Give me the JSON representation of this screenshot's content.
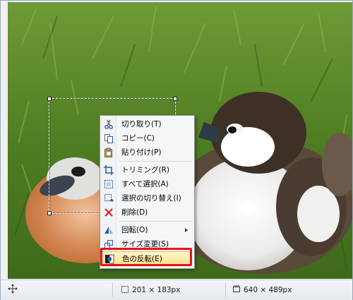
{
  "context_menu": {
    "items": [
      {
        "label": "切り取り(T)",
        "icon": "scissors-icon"
      },
      {
        "label": "コピー(C)",
        "icon": "copy-icon"
      },
      {
        "label": "貼り付け(P)",
        "icon": "paste-icon"
      },
      {
        "label": "トリミング(R)",
        "icon": "crop-icon"
      },
      {
        "label": "すべて選択(A)",
        "icon": "select-all-icon"
      },
      {
        "label": "選択の切り替え(I)",
        "icon": "invert-selection-icon"
      },
      {
        "label": "削除(D)",
        "icon": "delete-icon"
      },
      {
        "label": "回転(O)",
        "icon": "rotate-icon"
      },
      {
        "label": "サイズ変更(S)",
        "icon": "resize-icon"
      },
      {
        "label": "色の反転(E)",
        "icon": "invert-color-icon"
      }
    ],
    "highlighted_item": "色の反転(E)",
    "highlight_color": "#e8131e"
  },
  "status_bar": {
    "selection_size": "201 × 183px",
    "image_size": "640 × 489px"
  }
}
